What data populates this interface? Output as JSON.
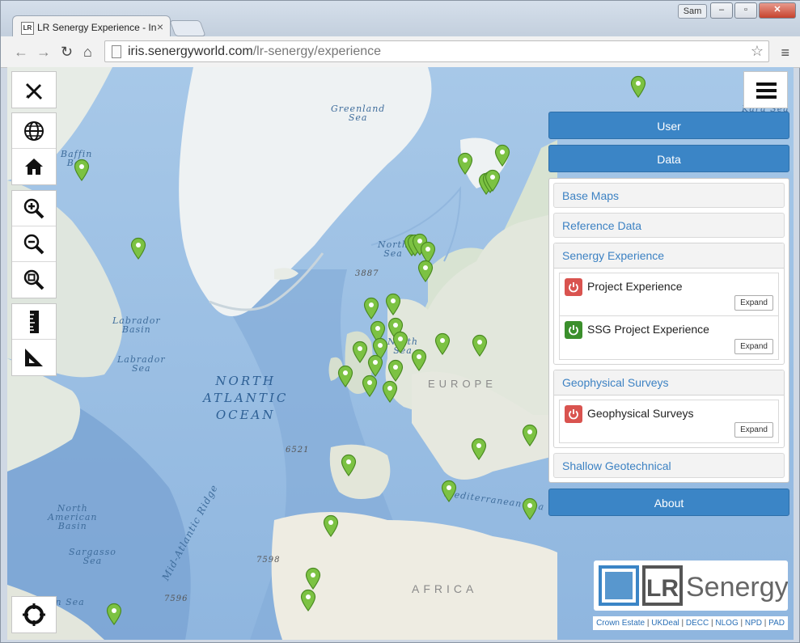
{
  "browser": {
    "tab_title": "LR Senergy Experience - In",
    "tab_favicon": "LR",
    "user_badge": "Sam",
    "url_host": "iris.senergyworld.com",
    "url_path": "/lr-senergy/experience",
    "icons": [
      "back-icon",
      "forward-icon",
      "reload-icon",
      "home-icon",
      "star-icon",
      "menu-icon"
    ]
  },
  "map": {
    "labels": {
      "greenland_sea": "Greenland\nSea",
      "baffin_bay": "Baffin\nBay",
      "labrador_basin": "Labrador\nBasin",
      "labrador_sea": "Labrador\nSea",
      "north_atlantic": "NORTH\nATLANTIC\nOCEAN",
      "north_sea": "North\nSea",
      "north_sea2": "North\nSea",
      "mid_atlantic": "Mid-Atlantic Ridge",
      "north_american_basin": "North\nAmerican\nBasin",
      "sargasso_sea": "Sargasso\nSea",
      "caribbean": "an Sea",
      "kara_sea": "Kara Sea",
      "mediterranean": "Mediterranean Sea",
      "europe": "EUROPE",
      "africa": "AFRICA",
      "depth_3887": "3887",
      "depth_6521": "6521",
      "depth_7598": "7598",
      "depth_7596": "7596"
    },
    "controls": [
      "edit-draw-icon",
      "globe-icon",
      "home-icon",
      "zoom-in-icon",
      "zoom-out-icon",
      "zoom-extent-icon",
      "ruler-icon",
      "triangle-measure-icon",
      "locate-icon"
    ],
    "attribution": [
      "Crown Estate",
      "UKDeal",
      "DECC",
      "NLOG",
      "NPD",
      "PAD"
    ],
    "logo_text": "Senergy",
    "logo_mark": "LR"
  },
  "panel": {
    "user_label": "User",
    "data_label": "Data",
    "about_label": "About",
    "sections": {
      "base_maps": "Base Maps",
      "reference_data": "Reference Data",
      "senergy_experience": "Senergy Experience",
      "geophysical_surveys": "Geophysical Surveys",
      "shallow_geotechnical": "Shallow Geotechnical"
    },
    "layers": {
      "project_experience": "Project Experience",
      "ssg_project_experience": "SSG Project Experience",
      "geophysical_surveys": "Geophysical Surveys"
    },
    "expand_label": "Expand",
    "colors": {
      "primary": "#3b85c6",
      "off": "#d9534f",
      "on": "#3b8f2c",
      "pin": "#7cc243"
    }
  }
}
